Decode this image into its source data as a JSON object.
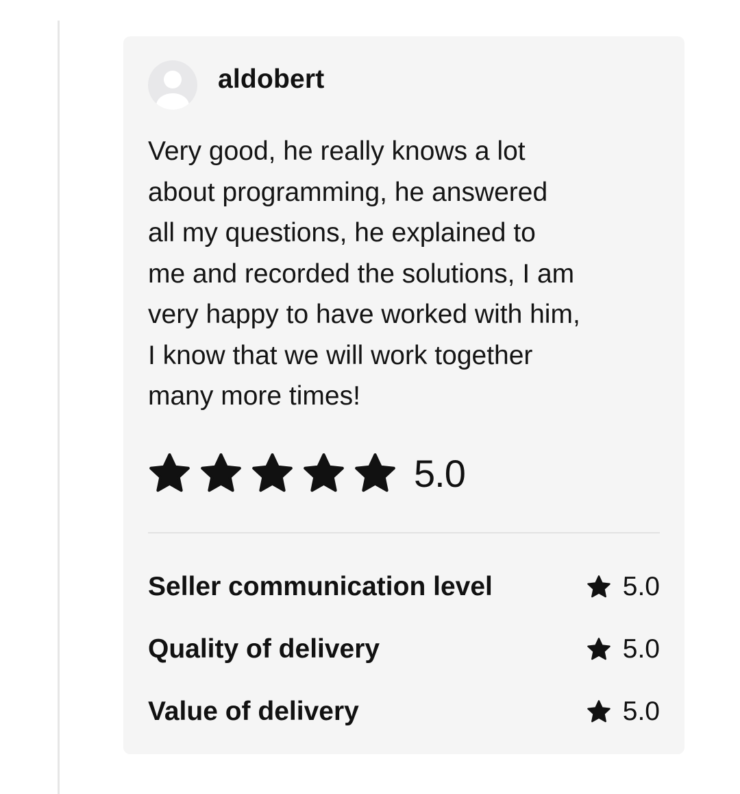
{
  "review": {
    "username": "aldobert",
    "avatar_icon": "default-user-avatar-icon",
    "text": "Very good, he really knows a lot\nabout programming, he answered\nall my questions, he explained to\nme and recorded the solutions, I am\nvery happy to have worked with him,\nI know that we will work together\nmany more times!",
    "overall_rating": {
      "stars": 5,
      "max_stars": 5,
      "score": "5.0",
      "star_icon": "star-icon"
    },
    "breakdown": [
      {
        "label": "Seller communication level",
        "score": "5.0"
      },
      {
        "label": "Quality of delivery",
        "score": "5.0"
      },
      {
        "label": "Value of delivery",
        "score": "5.0"
      }
    ]
  },
  "colors": {
    "card_background": "#f5f5f5",
    "text": "#111111",
    "star": "#111111",
    "divider": "#e2e2e2",
    "thread_line": "#e6e6e6",
    "avatar_background": "#e8e8ea"
  }
}
